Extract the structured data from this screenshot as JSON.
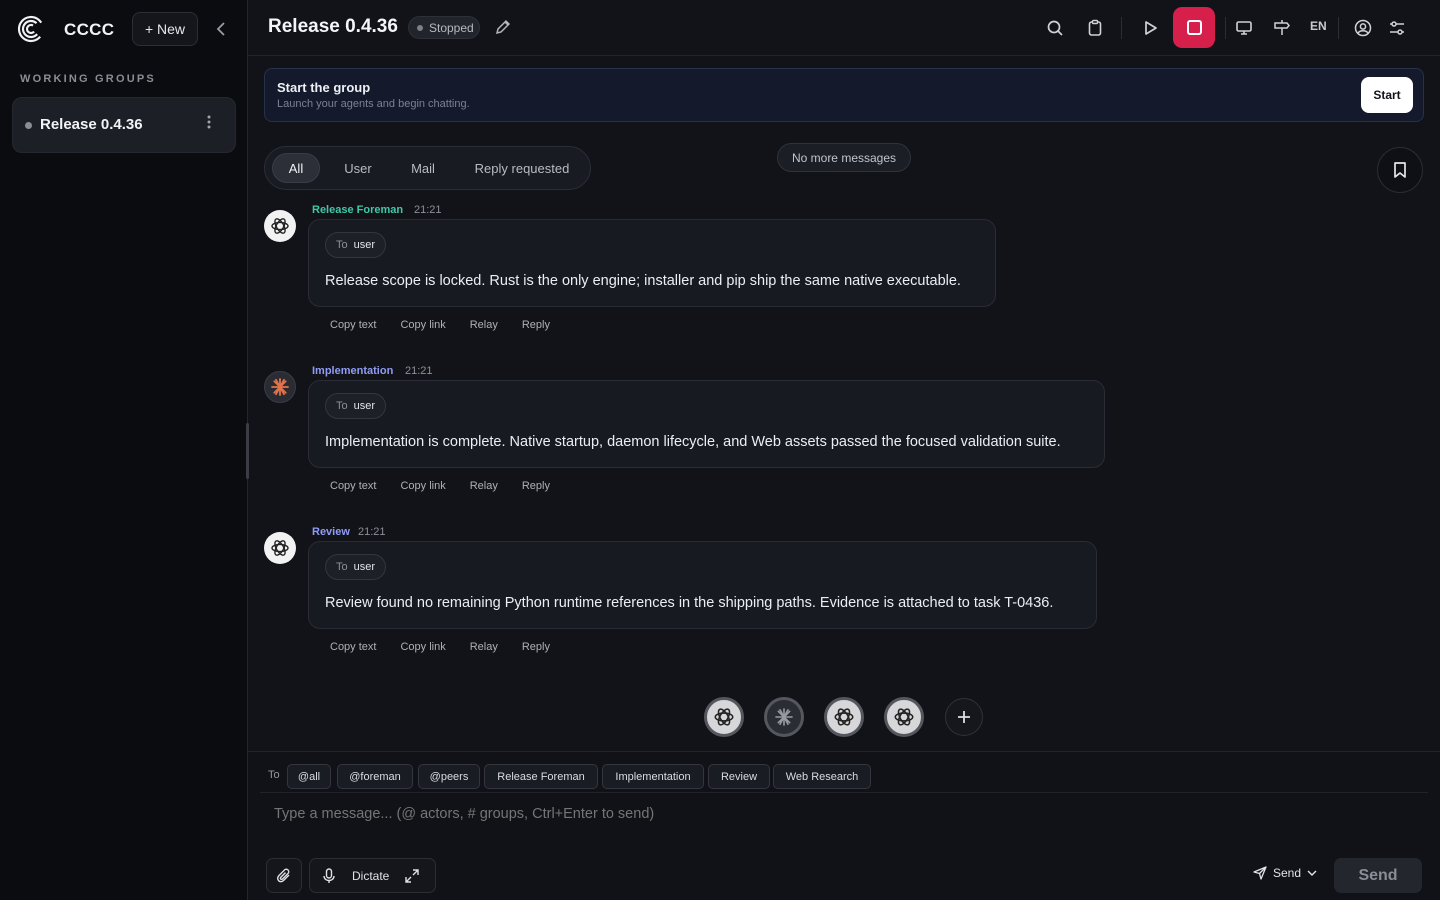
{
  "app": {
    "brand": "CCCC",
    "new_label": "+ New"
  },
  "sidebar": {
    "section_label": "WORKING GROUPS",
    "groups": [
      {
        "name": "Release 0.4.36"
      }
    ]
  },
  "header": {
    "title": "Release 0.4.36",
    "status": "Stopped",
    "lang": "EN",
    "accent_color": "#d61f4a"
  },
  "banner": {
    "title": "Start the group",
    "subtitle": "Launch your agents and begin chatting.",
    "button": "Start"
  },
  "filters": [
    {
      "label": "All",
      "active": true
    },
    {
      "label": "User",
      "active": false
    },
    {
      "label": "Mail",
      "active": false
    },
    {
      "label": "Reply requested",
      "active": false
    }
  ],
  "notice": "No more messages",
  "messages": [
    {
      "sender": "Release Foreman",
      "sender_color": "#3fc7a6",
      "time": "21:21",
      "avatar": "openai-icon",
      "to_prefix": "To",
      "to": "user",
      "text": "Release scope is locked. Rust is the only engine; installer and pip ship the same native executable."
    },
    {
      "sender": "Implementation",
      "sender_color": "#8f9cf5",
      "time": "21:21",
      "avatar": "claude-icon",
      "to_prefix": "To",
      "to": "user",
      "text": "Implementation is complete. Native startup, daemon lifecycle, and Web assets passed the focused validation suite."
    },
    {
      "sender": "Review",
      "sender_color": "#8f9cf5",
      "time": "21:21",
      "avatar": "openai-icon",
      "to_prefix": "To",
      "to": "user",
      "text": "Review found no remaining Python runtime references in the shipping paths. Evidence is attached to task T-0436."
    }
  ],
  "message_actions": [
    "Copy text",
    "Copy link",
    "Relay",
    "Reply"
  ],
  "composer": {
    "to_label": "To",
    "recipients": [
      "@all",
      "@foreman",
      "@peers",
      "Release Foreman",
      "Implementation",
      "Review",
      "Web Research"
    ],
    "placeholder": "Type a message... (@ actors, # groups, Ctrl+Enter to send)",
    "dictate_label": "Dictate",
    "send_mode_label": "Send",
    "send_label": "Send"
  }
}
